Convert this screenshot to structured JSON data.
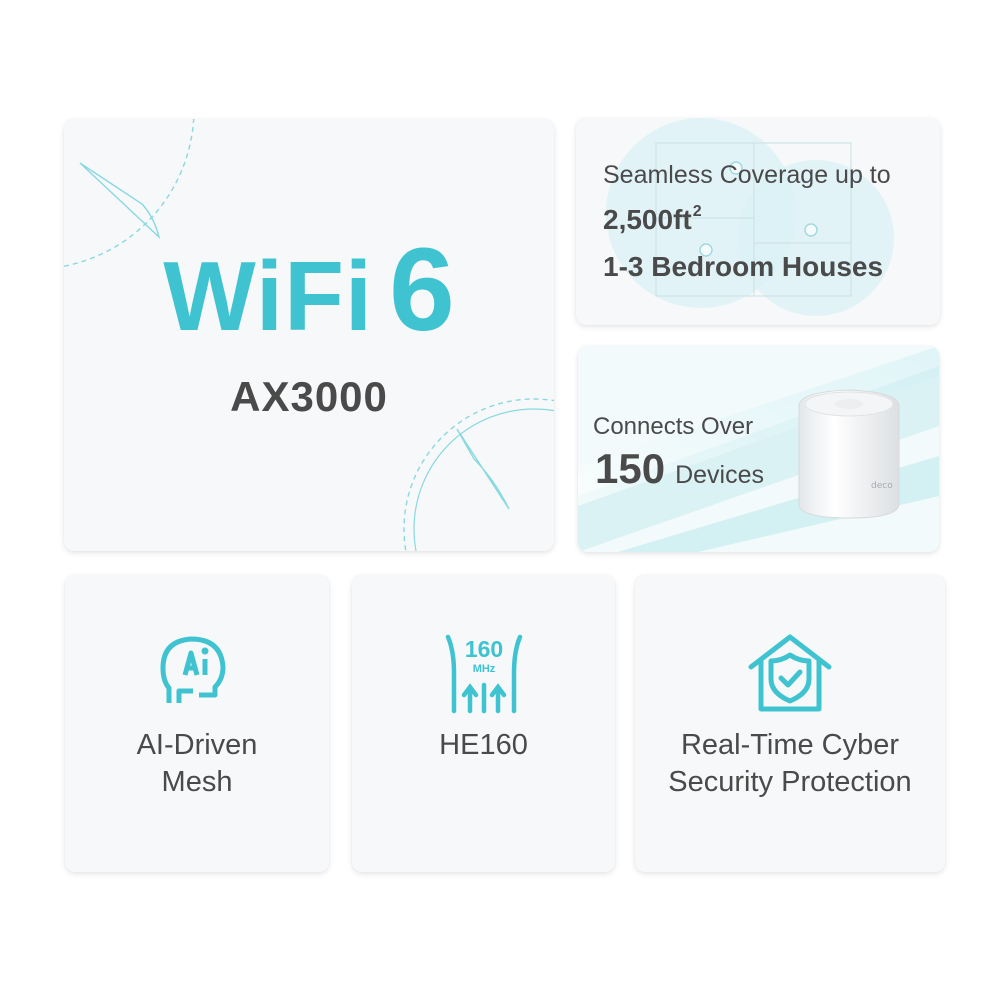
{
  "colors": {
    "accent": "#3fc3d1",
    "text": "#4a4a4a",
    "card": "#f7f8fa"
  },
  "wifi": {
    "word": "WiFi",
    "number": "6",
    "model": "AX3000"
  },
  "coverage": {
    "line1": "Seamless Coverage up to",
    "area": "2,500ft",
    "area_sup": "2",
    "houses": "1-3 Bedroom Houses"
  },
  "devices": {
    "line1": "Connects Over",
    "count": "150",
    "word": "Devices",
    "router_brand": "deco"
  },
  "features": [
    {
      "icon": "ai-head-icon",
      "line1": "AI-Driven",
      "line2": "Mesh"
    },
    {
      "icon": "he160-antenna-icon",
      "icon_number": "160",
      "icon_unit": "MHz",
      "line1": "HE160",
      "line2": ""
    },
    {
      "icon": "shield-house-icon",
      "line1": "Real-Time Cyber",
      "line2": "Security Protection"
    }
  ]
}
